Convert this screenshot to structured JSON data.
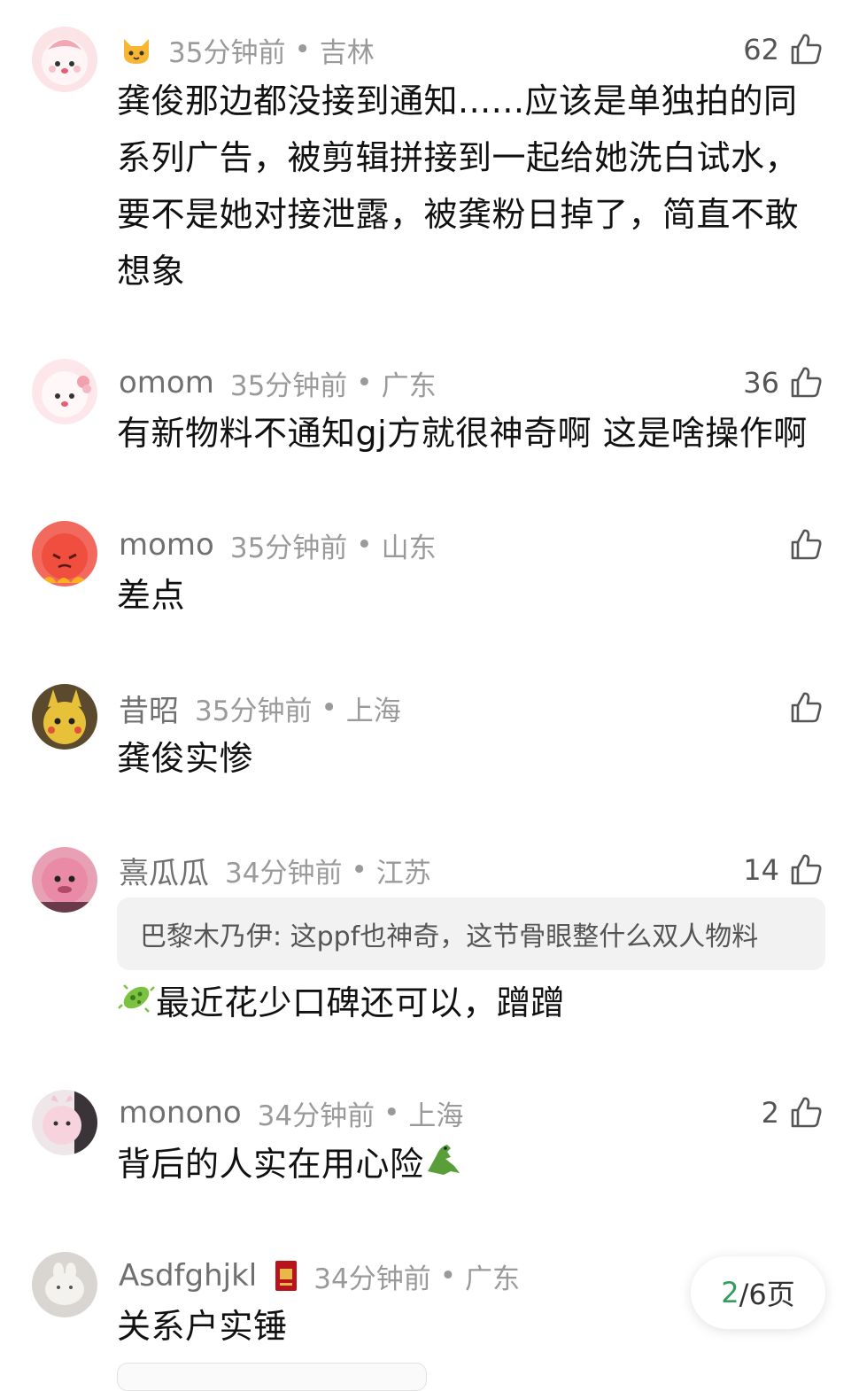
{
  "comments": [
    {
      "name": "",
      "badge_icon": "cat-face-icon",
      "time": "35分钟前",
      "location": "吉林",
      "likes": "62",
      "text": "龚俊那边都没接到通知......应该是单独拍的同系列广告，被剪辑拼接到一起给她洗白试水，要不是她对接泄露，被龚粉日掉了，简直不敢想象"
    },
    {
      "name": "omom",
      "time": "35分钟前",
      "location": "广东",
      "likes": "36",
      "text": "有新物料不通知gj方就很神奇啊 这是啥操作啊"
    },
    {
      "name": "momo",
      "time": "35分钟前",
      "location": "山东",
      "likes": "",
      "text": "差点"
    },
    {
      "name": "昔昭",
      "time": "35分钟前",
      "location": "上海",
      "likes": "",
      "text": "龚俊实惨"
    },
    {
      "name": "熹瓜瓜",
      "time": "34分钟前",
      "location": "江苏",
      "likes": "14",
      "reply": "巴黎木乃伊: 这ppf也神奇，这节骨眼整什么双人物料",
      "text_emoji": "microbe-icon",
      "text": "最近花少口碑还可以，蹭蹭"
    },
    {
      "name": "monono",
      "time": "34分钟前",
      "location": "上海",
      "likes": "2",
      "text": "背后的人实在用心险",
      "text_emoji_end": "crocodile-icon"
    },
    {
      "name": "Asdfghjkl",
      "badge_icon": "red-book-icon",
      "time": "34分钟前",
      "location": "广东",
      "likes": "",
      "text": "关系户实锤"
    }
  ],
  "sep": "•",
  "pager": {
    "current": "2",
    "total": "/6页"
  },
  "colors": {
    "accent_green": "#2f9e5e",
    "meta_gray": "#9a9a9a"
  }
}
